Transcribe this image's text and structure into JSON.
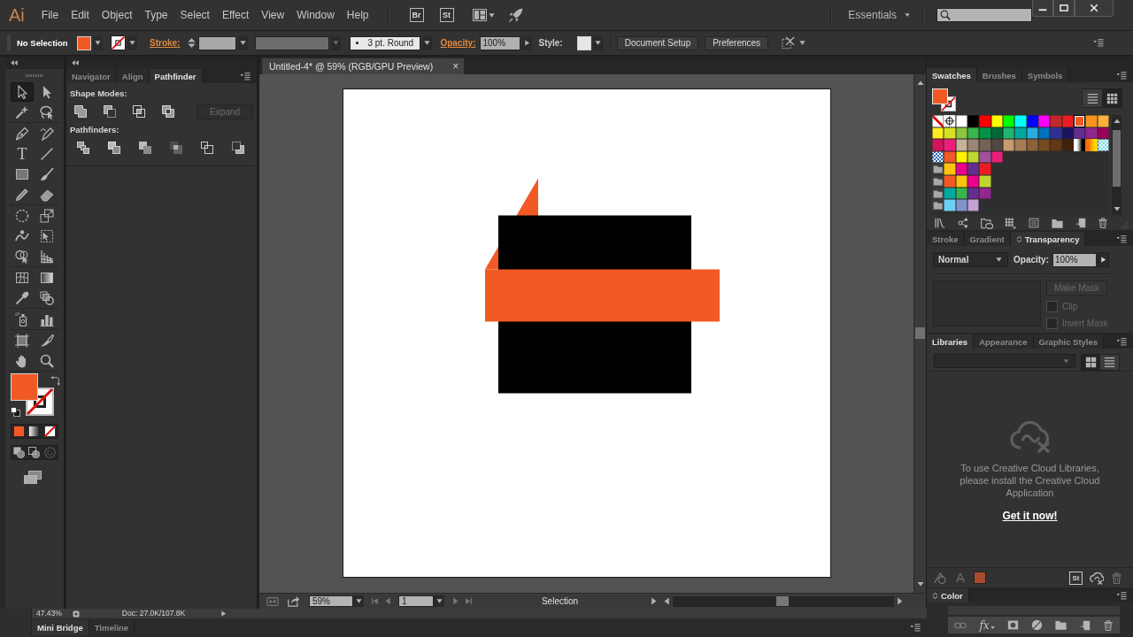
{
  "menu_bar": {
    "logo": "Ai",
    "menus": [
      "File",
      "Edit",
      "Object",
      "Type",
      "Select",
      "Effect",
      "View",
      "Window",
      "Help"
    ],
    "app_buttons": [
      "Br",
      "St"
    ],
    "workspace": "Essentials"
  },
  "control_bar": {
    "selection": "No Selection",
    "fill": {
      "color": "#f15a24"
    },
    "stroke_label": "Stroke:",
    "brush": "3 pt. Round",
    "opacity_label": "Opacity:",
    "opacity": "100%",
    "style_label": "Style:",
    "buttons": [
      "Document Setup",
      "Preferences"
    ]
  },
  "toolbox": {
    "tools": [
      {
        "selected": true
      },
      {
        "selected": false
      },
      {
        "selected": false
      },
      {
        "selected": false
      },
      {
        "selected": false
      },
      {
        "selected": false
      },
      {
        "glyph": "T",
        "selected": false
      },
      {
        "selected": false
      },
      {
        "selected": false
      },
      {
        "selected": false
      },
      {
        "selected": false
      },
      {
        "selected": false
      },
      {
        "selected": false
      },
      {
        "selected": false
      },
      {
        "selected": false
      },
      {
        "selected": false
      },
      {
        "selected": false
      },
      {
        "selected": false
      },
      {
        "selected": false
      },
      {
        "selected": false
      },
      {
        "selected": false
      },
      {
        "selected": false
      },
      {
        "selected": false
      },
      {
        "selected": false
      },
      {
        "selected": false
      },
      {
        "selected": false
      },
      {
        "selected": false
      },
      {
        "selected": false
      }
    ],
    "fill": {
      "color": "#f15a24"
    }
  },
  "pathfinder_panel": {
    "tabs": [
      {
        "label": "Navigator",
        "selected": false
      },
      {
        "label": "Align",
        "selected": false
      },
      {
        "label": "Pathfinder",
        "selected": true
      }
    ],
    "shape_modes_label": "Shape Modes:",
    "expand_button": {
      "label": "Expand",
      "disabled": true
    },
    "pathfinders_label": "Pathfinders:"
  },
  "document": {
    "tab": {
      "title": "Untitled-4* @ 59% (RGB/GPU Preview)",
      "close": "×"
    },
    "artwork": [
      {
        "kind": "triangle",
        "color": "#f15a24"
      },
      {
        "kind": "square",
        "color": "#000000"
      },
      {
        "kind": "band",
        "color": "#f15a24"
      }
    ],
    "status_bar": {
      "zoom": "59%",
      "page": "1",
      "tool": "Selection"
    }
  },
  "info_bar": {
    "zoom": "47.43%",
    "doc_size": "Doc: 27.0K/107.8K"
  },
  "bottom_panel": {
    "tabs": [
      {
        "label": "Mini Bridge",
        "selected": true
      },
      {
        "label": "Timeline",
        "selected": false
      }
    ]
  },
  "swatches_panel": {
    "tabs": [
      {
        "label": "Swatches",
        "selected": true
      },
      {
        "label": "Brushes",
        "selected": false
      },
      {
        "label": "Symbols",
        "selected": false
      }
    ],
    "fill": {
      "color": "#f15a24"
    },
    "view_buttons": [
      {
        "selected": false
      },
      {
        "selected": true
      }
    ],
    "swatches": [
      {
        "kind": "none",
        "selected": false
      },
      {
        "kind": "registration",
        "selected": false
      },
      {
        "kind": "color",
        "color": "#ffffff",
        "selected": false
      },
      {
        "kind": "color",
        "color": "#000000",
        "selected": false
      },
      {
        "kind": "color",
        "color": "#ff0000",
        "selected": false
      },
      {
        "kind": "color",
        "color": "#ffff00",
        "selected": false
      },
      {
        "kind": "color",
        "color": "#00ff00",
        "selected": false
      },
      {
        "kind": "color",
        "color": "#00ffff",
        "selected": false
      },
      {
        "kind": "color",
        "color": "#0000ff",
        "selected": false
      },
      {
        "kind": "color",
        "color": "#ff00ff",
        "selected": false
      },
      {
        "kind": "color",
        "color": "#c1272d",
        "selected": false
      },
      {
        "kind": "color",
        "color": "#ed1c24",
        "selected": false
      },
      {
        "kind": "color",
        "color": "#f15a24",
        "selected": true
      },
      {
        "kind": "color",
        "color": "#f7931e",
        "selected": false
      },
      {
        "kind": "color",
        "color": "#fbb03b",
        "selected": false
      },
      {
        "kind": "color",
        "color": "#fcee21",
        "selected": false
      },
      {
        "kind": "color",
        "color": "#d9e021",
        "selected": false
      },
      {
        "kind": "color",
        "color": "#8cc63f",
        "selected": false
      },
      {
        "kind": "color",
        "color": "#39b54a",
        "selected": false
      },
      {
        "kind": "color",
        "color": "#009245",
        "selected": false
      },
      {
        "kind": "color",
        "color": "#006837",
        "selected": false
      },
      {
        "kind": "color",
        "color": "#22b573",
        "selected": false
      },
      {
        "kind": "color",
        "color": "#00a99d",
        "selected": false
      },
      {
        "kind": "color",
        "color": "#29abe2",
        "selected": false
      },
      {
        "kind": "color",
        "color": "#0071bc",
        "selected": false
      },
      {
        "kind": "color",
        "color": "#2e3192",
        "selected": false
      },
      {
        "kind": "color",
        "color": "#1b1464",
        "selected": false
      },
      {
        "kind": "color",
        "color": "#662d91",
        "selected": false
      },
      {
        "kind": "color",
        "color": "#93278f",
        "selected": false
      },
      {
        "kind": "color",
        "color": "#9e005d",
        "selected": false
      },
      {
        "kind": "color",
        "color": "#d4145a",
        "selected": false
      },
      {
        "kind": "color",
        "color": "#ed1e79",
        "selected": false
      },
      {
        "kind": "color",
        "color": "#c7b299",
        "selected": false
      },
      {
        "kind": "color",
        "color": "#998675",
        "selected": false
      },
      {
        "kind": "color",
        "color": "#736357",
        "selected": false
      },
      {
        "kind": "color",
        "color": "#534741",
        "selected": false
      },
      {
        "kind": "color",
        "color": "#c69c6d",
        "selected": false
      },
      {
        "kind": "color",
        "color": "#a67c52",
        "selected": false
      },
      {
        "kind": "color",
        "color": "#8c6239",
        "selected": false
      },
      {
        "kind": "color",
        "color": "#754c24",
        "selected": false
      },
      {
        "kind": "color",
        "color": "#603813",
        "selected": false
      },
      {
        "kind": "color",
        "color": "#42210b",
        "selected": false
      },
      {
        "kind": "gradient",
        "stops": [
          {
            "color": "#ffffff"
          },
          {
            "color": "#000000"
          }
        ],
        "selected": false
      },
      {
        "kind": "gradient",
        "stops": [
          {
            "color": "#ff6a00"
          },
          {
            "color": "#ffd800"
          }
        ],
        "selected": false
      },
      {
        "kind": "pattern",
        "color": "#6fd9e6",
        "selected": false
      },
      {
        "kind": "pattern",
        "color": "#2a6bb5",
        "selected": false
      },
      {
        "kind": "color",
        "color": "#f15a24",
        "selected": false
      },
      {
        "kind": "color",
        "color": "#fff200",
        "selected": false
      },
      {
        "kind": "color",
        "color": "#bfd730",
        "selected": false
      },
      {
        "kind": "color",
        "color": "#a4509e",
        "selected": false
      },
      {
        "kind": "color",
        "color": "#ed1e79",
        "selected": false
      }
    ],
    "groups": [
      {
        "swatches": [
          {
            "color": "#ffc20e",
            "selected": false
          },
          {
            "color": "#ec008c",
            "selected": false
          },
          {
            "color": "#662d91",
            "selected": false
          },
          {
            "color": "#ed1c24",
            "selected": false
          }
        ]
      },
      {
        "swatches": [
          {
            "color": "#f15a24",
            "selected": false
          },
          {
            "color": "#ffc20e",
            "selected": false
          },
          {
            "color": "#ec008c",
            "selected": false
          },
          {
            "color": "#bfd730",
            "selected": false
          }
        ]
      },
      {
        "swatches": [
          {
            "color": "#00a99d",
            "selected": false
          },
          {
            "color": "#39b54a",
            "selected": false
          },
          {
            "color": "#662d91",
            "selected": false
          },
          {
            "color": "#92278f",
            "selected": false
          }
        ]
      },
      {
        "swatches": [
          {
            "color": "#6dcff6",
            "selected": false
          },
          {
            "color": "#8393ca",
            "selected": false
          },
          {
            "color": "#c4a0d4",
            "selected": false
          }
        ]
      }
    ]
  },
  "transparency_panel": {
    "tabs": [
      {
        "label": "Stroke",
        "selected": false
      },
      {
        "label": "Gradient",
        "selected": false
      },
      {
        "label": "Transparency",
        "selected": true
      }
    ],
    "blend_mode": "Normal",
    "opacity_label": "Opacity:",
    "opacity": "100%",
    "make_mask": {
      "label": "Make Mask",
      "disabled": true
    },
    "options": [
      {
        "label": "Clip",
        "checked": false,
        "disabled": true
      },
      {
        "label": "Invert Mask",
        "checked": false,
        "disabled": true
      }
    ]
  },
  "libraries_panel": {
    "tabs": [
      {
        "label": "Libraries",
        "selected": true
      },
      {
        "label": "Appearance",
        "selected": false
      },
      {
        "label": "Graphic Styles",
        "selected": false
      }
    ],
    "view_buttons": [
      {
        "selected": true
      },
      {
        "selected": false
      }
    ],
    "message": "To use Creative Cloud Libraries, please install the Creative Cloud Application",
    "link": "Get it now!",
    "footer_glyphs": [
      "A",
      "St"
    ]
  },
  "color_panel": {
    "tab": "Color"
  },
  "layers_footer": {
    "effects_label": "fx"
  }
}
